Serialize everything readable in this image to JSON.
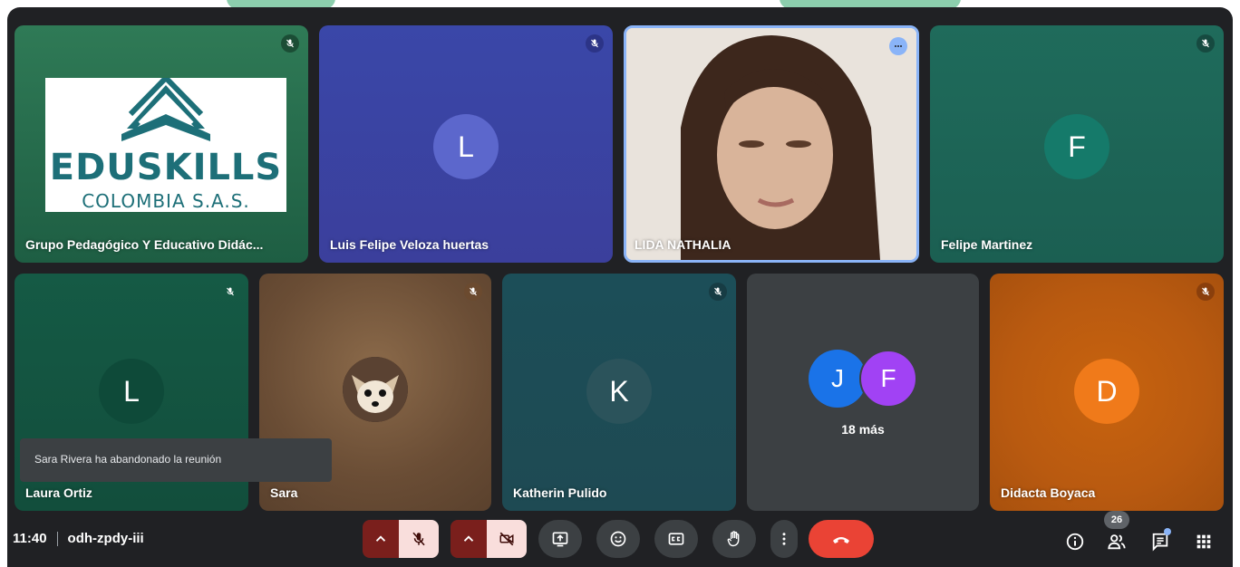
{
  "meeting": {
    "time": "11:40",
    "code": "odh-zpdy-iii",
    "participant_count": "26"
  },
  "toast": {
    "text": "Sara Rivera ha abandonado la reunión"
  },
  "logo": {
    "brand": "EDUSKILLS",
    "subtitle": "COLOMBIA S.A.S."
  },
  "tiles": [
    {
      "name": "Grupo Pedagógico Y Educativo Didác...",
      "muted": true
    },
    {
      "name": "Luis Felipe Veloza huertas",
      "initial": "L",
      "muted": true
    },
    {
      "name": "LIDA NATHALIA",
      "speaking": true
    },
    {
      "name": "Felipe Martinez",
      "initial": "F",
      "muted": true
    },
    {
      "name": "Laura Ortiz",
      "initial": "L",
      "muted": true
    },
    {
      "name": "Sara",
      "muted": true
    },
    {
      "name": "Katherin Pulido",
      "initial": "K",
      "muted": true
    },
    {
      "others": {
        "initials": [
          "J",
          "F"
        ],
        "label": "18 más"
      }
    },
    {
      "name": "Didacta Boyaca",
      "initial": "D",
      "muted": true
    }
  ],
  "icons": {
    "controls": [
      "chevron-up-icon",
      "mic-off-icon",
      "chevron-up-icon",
      "camera-off-icon",
      "present-icon",
      "emoji-icon",
      "captions-icon",
      "raise-hand-icon",
      "more-vert-icon",
      "hangup-icon"
    ],
    "right": [
      "info-icon",
      "people-icon",
      "chat-icon",
      "activities-icon"
    ]
  },
  "colors": {
    "mic_button_bg": "#f9dedc",
    "control_bg": "#3c4043",
    "hangup": "#ea4335",
    "logo_teal": "#1d6f78",
    "speaking_border": "#8ab4f8"
  }
}
